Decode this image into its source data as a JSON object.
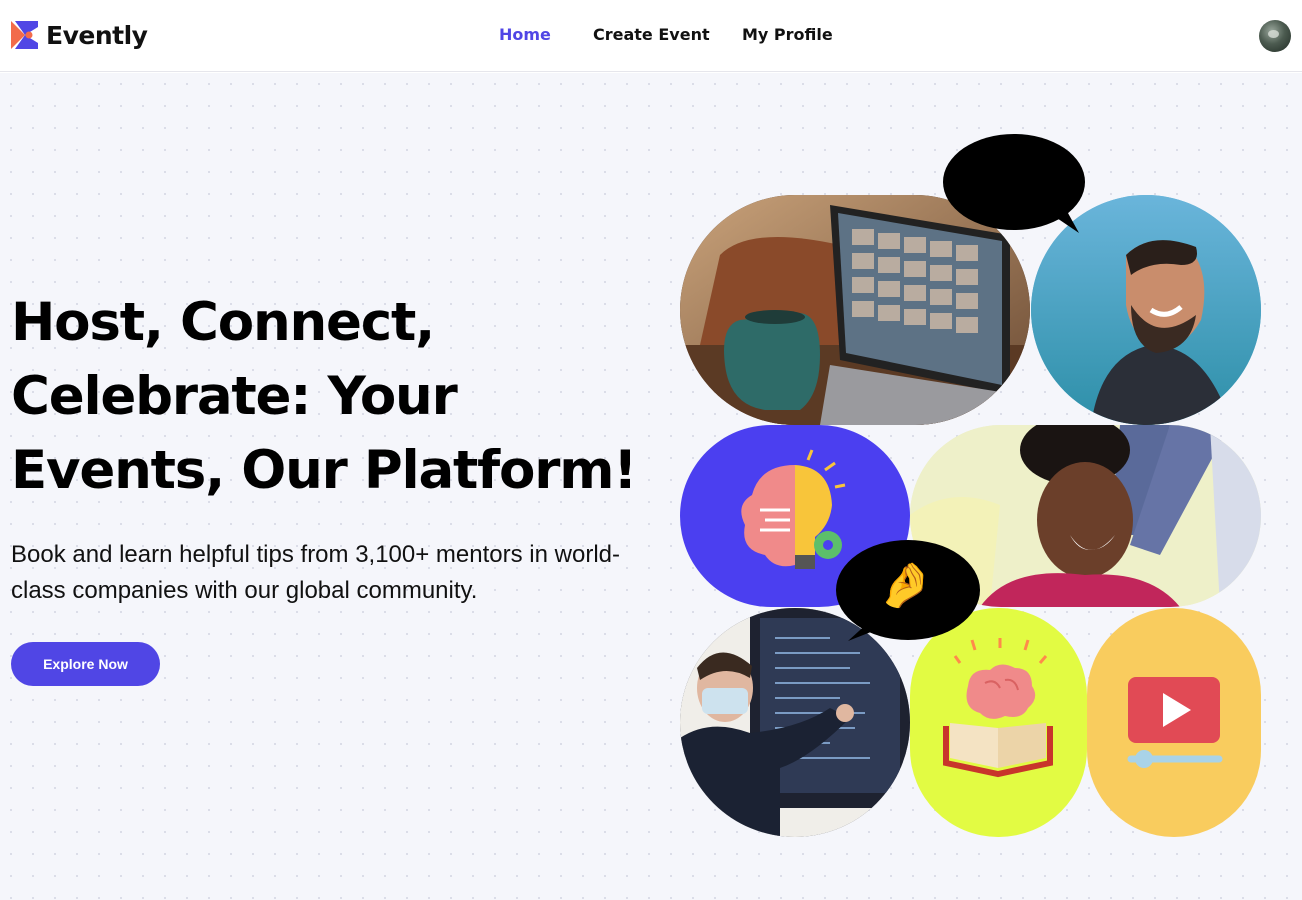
{
  "brand": {
    "name": "Evently",
    "colors": {
      "primary": "#5046e5",
      "logo_orange": "#f26b4b"
    }
  },
  "nav": {
    "links": [
      {
        "label": "Home",
        "active": true
      },
      {
        "label": "Create Event",
        "active": false
      },
      {
        "label": "My Profile",
        "active": false
      }
    ]
  },
  "hero": {
    "headline": "Host, Connect, Celebrate: Your Events, Our Platform!",
    "subtext": "Book and learn helpful tips from 3,100+ mentors in world-class companies with our global community.",
    "cta_label": "Explore Now"
  },
  "collage": {
    "tiles": [
      {
        "name": "video-call-laptop-photo",
        "kind": "photo"
      },
      {
        "name": "laughing-man-photo",
        "kind": "photo"
      },
      {
        "name": "brain-lightbulb-illustration",
        "kind": "illustration",
        "bg": "#4b3ff0"
      },
      {
        "name": "smiling-woman-photo",
        "kind": "photo"
      },
      {
        "name": "presenter-photo",
        "kind": "photo"
      },
      {
        "name": "brain-book-illustration",
        "kind": "illustration",
        "bg": "#e2fb43"
      },
      {
        "name": "video-player-illustration",
        "kind": "illustration",
        "bg": "#f9cc5e"
      }
    ],
    "bubbles": [
      {
        "name": "heart-eyes-emoji",
        "emoji": "😍"
      },
      {
        "name": "pinching-hand-emoji",
        "emoji": "🤌"
      }
    ]
  }
}
